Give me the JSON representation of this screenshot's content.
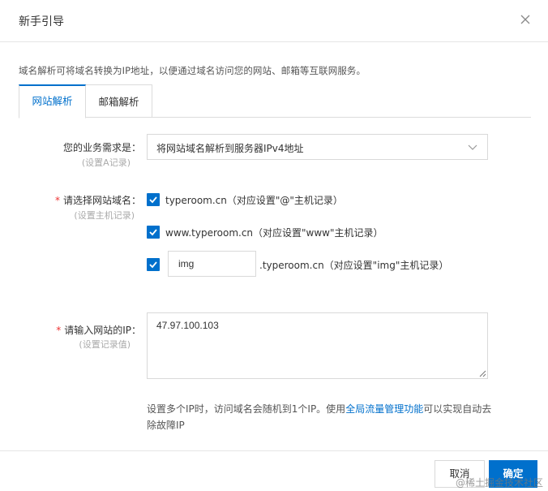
{
  "dialog": {
    "title": "新手引导",
    "close_icon": "close-icon"
  },
  "intro_text": "域名解析可将域名转换为IP地址，以便通过域名访问您的网站、邮箱等互联网服务。",
  "tabs": [
    {
      "label": "网站解析",
      "active": true
    },
    {
      "label": "邮箱解析",
      "active": false
    }
  ],
  "business": {
    "label": "您的业务需求是：",
    "sublabel": "(设置A记录)",
    "selected": "将网站域名解析到服务器IPv4地址",
    "arrow_icon": "chevron-down-icon"
  },
  "domain": {
    "label": "请选择网站域名：",
    "sublabel": "(设置主机记录)",
    "required_mark": "*",
    "options": [
      {
        "text": "typeroom.cn（对应设置\"@\"主机记录）",
        "checked": true
      },
      {
        "text": "www.typeroom.cn（对应设置\"www\"主机记录）",
        "checked": true
      }
    ],
    "custom": {
      "checked": true,
      "prefix_value": "img",
      "suffix_text": ".typeroom.cn（对应设置\"img\"主机记录）"
    }
  },
  "ip": {
    "label": "请输入网站的IP：",
    "sublabel": "(设置记录值)",
    "required_mark": "*",
    "value": "47.97.100.103"
  },
  "help": {
    "text_before": "设置多个IP时，访问域名会随机到1个IP。使用",
    "link": "全局流量管理功能",
    "text_after": "可以实现自动去除故障IP"
  },
  "footer": {
    "cancel_label": "取消",
    "ok_label": "确定"
  },
  "watermark": "@稀土掘金技术社区",
  "colors": {
    "accent": "#0070cc",
    "required": "#e33333"
  }
}
